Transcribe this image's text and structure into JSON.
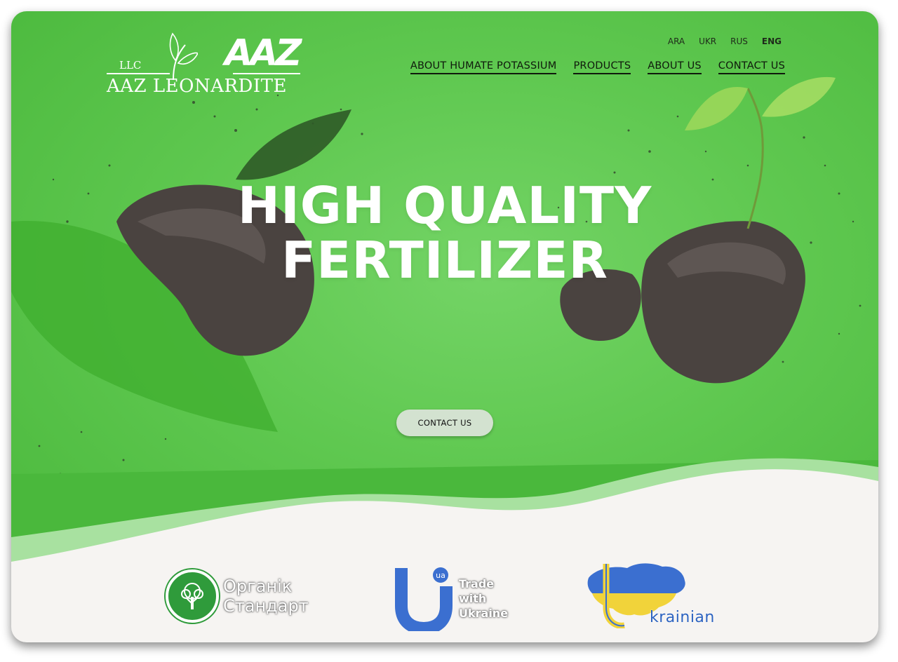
{
  "brand": {
    "llc": "LLC",
    "name": "AAZ LEONARDITE",
    "mark": "AAZ"
  },
  "languages": [
    {
      "label": "ARA",
      "active": false
    },
    {
      "label": "UKR",
      "active": false
    },
    {
      "label": "RUS",
      "active": false
    },
    {
      "label": "ENG",
      "active": true
    }
  ],
  "nav": {
    "items": [
      "ABOUT HUMATE POTASSIUM",
      "PRODUCTS",
      "ABOUT US",
      "CONTACT US"
    ]
  },
  "hero": {
    "headline_line1": "HIGH QUALITY",
    "headline_line2": "FERTILIZER",
    "cta_label": "CONTACT US"
  },
  "partners": {
    "organic": {
      "line1": "Органік",
      "line2": "Стандарт",
      "icon": "tree-icon"
    },
    "trade": {
      "badge": "ua",
      "line1": "Trade",
      "line2": "with",
      "line3": "Ukraine"
    },
    "ukrainian": {
      "label": "krainian",
      "icon": "ukraine-map-icon"
    }
  },
  "colors": {
    "hero_green": "#5fc850",
    "cta_bg": "#d3e2d0",
    "nav_text": "#0f1a0c",
    "footer_bg": "#f6f4f2",
    "trade_blue": "#3b6fd0",
    "ukraine_yellow": "#f1d33a"
  }
}
